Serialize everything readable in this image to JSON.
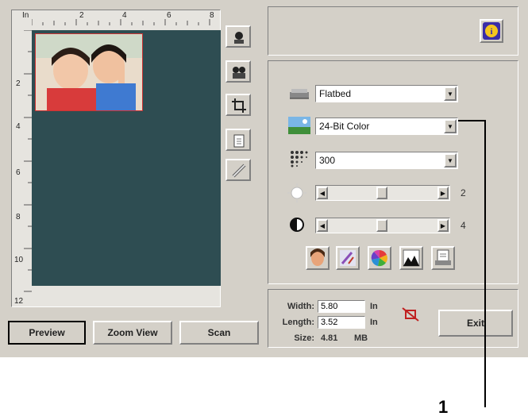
{
  "ruler": {
    "unit": "In",
    "h_ticks": [
      "2",
      "4",
      "6",
      "8"
    ],
    "v_ticks": [
      "2",
      "4",
      "6",
      "8",
      "10",
      "12"
    ]
  },
  "buttons": {
    "preview": "Preview",
    "zoom_view": "Zoom View",
    "scan": "Scan",
    "exit": "Exit"
  },
  "scan_source": {
    "value": "Flatbed"
  },
  "image_type": {
    "value": "24-Bit Color"
  },
  "resolution": {
    "value": "300"
  },
  "brightness": {
    "value": "2",
    "level": 0.5
  },
  "contrast": {
    "value": "4",
    "level": 0.5
  },
  "dimensions": {
    "width_label": "Width",
    "width_value": "5.80",
    "width_unit": "In",
    "length_label": "Length",
    "length_value": "3.52",
    "length_unit": "In",
    "size_label": "Size",
    "size_value": "4.81",
    "size_unit": "MB"
  },
  "callout": {
    "number": "1"
  },
  "icons": {
    "vertical_toolbar": [
      "auto-scan-icon",
      "multi-scan-icon",
      "crop-icon",
      "clipboard-icon",
      "ruler-icon"
    ],
    "bottom_tools": [
      "face-icon",
      "brush-icon",
      "color-wheel-icon",
      "filter-icon",
      "document-icon"
    ],
    "info": "info-icon",
    "no_crop": "no-crop-icon"
  },
  "colors": {
    "window": "#d4d0c8",
    "preview_bg": "#2e4d52",
    "info_button": "#3a2da8"
  }
}
